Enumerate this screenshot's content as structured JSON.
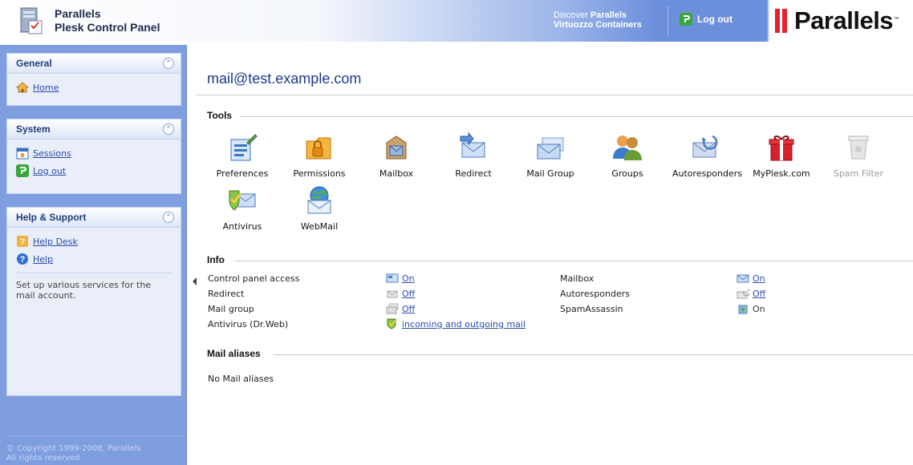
{
  "header": {
    "brand_line1": "Parallels",
    "brand_line2": "Plesk Control Panel",
    "discover_prefix": "Discover",
    "discover_brand": "Parallels",
    "discover_line2": "Virtuozzo Containers",
    "logout_label": "Log out",
    "logo_text": "Parallels",
    "logo_tm": "™"
  },
  "sidebar": {
    "general": {
      "title": "General",
      "items": [
        {
          "label": "Home",
          "icon": "home-icon"
        }
      ]
    },
    "system": {
      "title": "System",
      "items": [
        {
          "label": "Sessions",
          "icon": "sessions-icon"
        },
        {
          "label": "Log out",
          "icon": "logout-icon"
        }
      ]
    },
    "help": {
      "title": "Help & Support",
      "items": [
        {
          "label": "Help Desk",
          "icon": "help-desk-icon"
        },
        {
          "label": "Help",
          "icon": "help-icon"
        }
      ],
      "text": "Set up various services for the mail account."
    },
    "copyright_line1": "© Copyright 1999-2008, Parallels",
    "copyright_line2": "All rights reserved"
  },
  "main": {
    "title": "mail@test.example.com",
    "tools_heading": "Tools",
    "tools": [
      {
        "label": "Preferences",
        "icon": "preferences-icon",
        "enabled": true
      },
      {
        "label": "Permissions",
        "icon": "permissions-icon",
        "enabled": true
      },
      {
        "label": "Mailbox",
        "icon": "mailbox-icon",
        "enabled": true
      },
      {
        "label": "Redirect",
        "icon": "redirect-icon",
        "enabled": true
      },
      {
        "label": "Mail Group",
        "icon": "mail-group-icon",
        "enabled": true
      },
      {
        "label": "Groups",
        "icon": "groups-icon",
        "enabled": true
      },
      {
        "label": "Autoresponders",
        "icon": "autoresponders-icon",
        "enabled": true
      },
      {
        "label": "MyPlesk.com",
        "icon": "myplesk-icon",
        "enabled": true
      },
      {
        "label": "Spam Filter",
        "icon": "spam-filter-icon",
        "enabled": false
      },
      {
        "label": "Antivirus",
        "icon": "antivirus-icon",
        "enabled": true
      },
      {
        "label": "WebMail",
        "icon": "webmail-icon",
        "enabled": true
      }
    ],
    "info_heading": "Info",
    "info_left": [
      {
        "label": "Control panel access",
        "value": "On",
        "icon": "control-panel-icon"
      },
      {
        "label": "Redirect",
        "value": "Off",
        "icon": "redirect-small-icon"
      },
      {
        "label": "Mail group",
        "value": "Off",
        "icon": "mail-group-small-icon"
      },
      {
        "label": "Antivirus (Dr.Web)",
        "value": "incoming and outgoing mail",
        "icon": "antivirus-small-icon"
      }
    ],
    "info_right": [
      {
        "label": "Mailbox",
        "value": "On",
        "icon": "mailbox-small-icon"
      },
      {
        "label": "Autoresponders",
        "value": "Off",
        "icon": "autoresponders-small-icon"
      },
      {
        "label": "SpamAssassin",
        "value": "On",
        "icon": "spamassassin-small-icon"
      }
    ],
    "aliases_heading": "Mail aliases",
    "aliases_empty": "No Mail aliases"
  },
  "colors": {
    "sidebar_bg": "#7f9ee0",
    "panel_bg": "#e9eef9",
    "title_blue": "#1a3a8e",
    "link_blue": "#2a4bb0",
    "logo_red": "#e3232b"
  }
}
